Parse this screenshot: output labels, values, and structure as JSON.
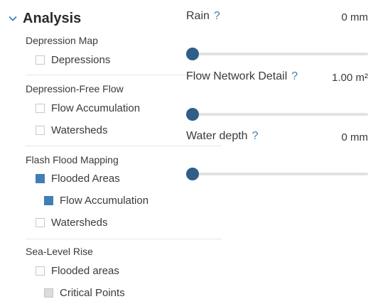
{
  "analysis": {
    "title": "Analysis",
    "groups": [
      {
        "label": "Depression Map",
        "items": [
          {
            "label": "Depressions",
            "checked": false
          }
        ]
      },
      {
        "label": "Depression-Free Flow",
        "items": [
          {
            "label": "Flow Accumulation",
            "checked": false
          },
          {
            "label": "Watersheds",
            "checked": false
          }
        ]
      },
      {
        "label": "Flash Flood Mapping",
        "items": [
          {
            "label": "Flooded Areas",
            "checked": true
          },
          {
            "label": "Flow Accumulation",
            "checked": true
          },
          {
            "label": "Watersheds",
            "checked": false
          }
        ]
      },
      {
        "label": "Sea-Level Rise",
        "items": [
          {
            "label": "Flooded areas",
            "checked": false
          },
          {
            "label": "Critical Points",
            "checked": false,
            "disabled": true
          }
        ]
      }
    ]
  },
  "sliders": [
    {
      "label": "Rain",
      "help": "?",
      "value": "0 mm",
      "position": 0
    },
    {
      "label": "Flow Network Detail",
      "help": "?",
      "value": "1.00 m²",
      "position": 0
    },
    {
      "label": "Water depth",
      "help": "?",
      "value": "0 mm",
      "position": 0
    }
  ],
  "colors": {
    "checked": "#3f7fb5",
    "thumb": "#2f5e88",
    "help": "#3f7fb5"
  }
}
